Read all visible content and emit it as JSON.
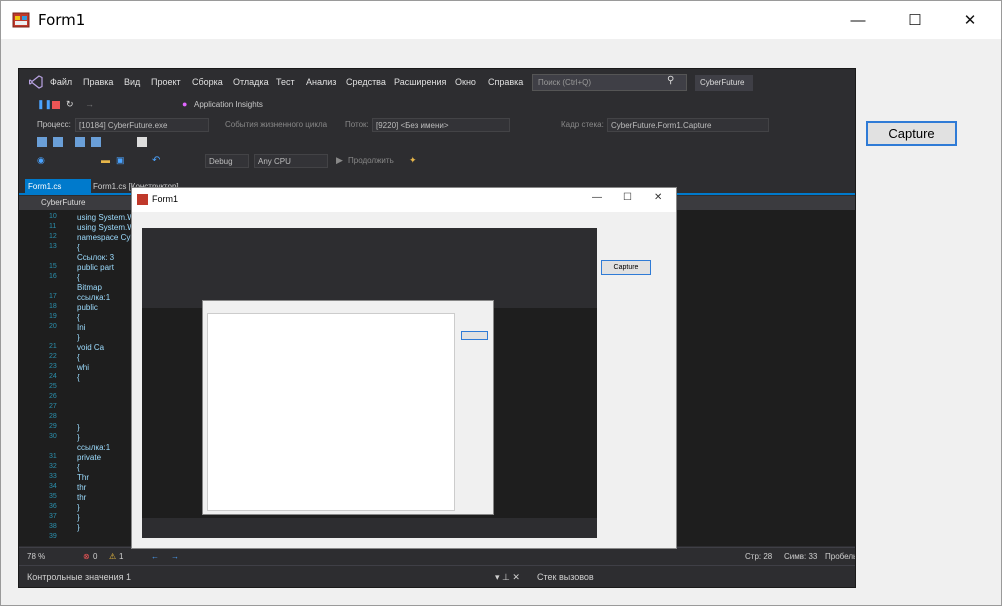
{
  "window": {
    "title": "Form1",
    "controls": {
      "minimize": "—",
      "maximize": "☐",
      "close": "✕"
    }
  },
  "capture_button": {
    "label": "Capture"
  },
  "screenshot": {
    "menu": [
      "Файл",
      "Правка",
      "Вид",
      "Проект",
      "Сборка",
      "Отладка",
      "Тест",
      "Анализ",
      "Средства",
      "Расширения",
      "Окно",
      "Справка"
    ],
    "search_placeholder": "Поиск (Ctrl+Q)",
    "profile": "CyberFuture",
    "toolbar": {
      "app_insights": "Application Insights",
      "process_label": "Процесс:",
      "process_value": "[10184] CyberFuture.exe",
      "lifecycle": "События жизненного цикла",
      "thread_label": "Поток:",
      "thread_value": "[9220] <Без имени>",
      "stack_label": "Кадр стека:",
      "stack_value": "CyberFuture.Form1.Capture",
      "config": "Debug",
      "platform": "Any CPU",
      "continue": "Продолжить"
    },
    "tabs": {
      "active": "Form1.cs",
      "other": "Form1.cs [Конструктор]"
    },
    "breadcrumb": "CyberFuture",
    "lines": [
      {
        "n": "10",
        "code": "using System.W"
      },
      {
        "n": "11",
        "code": "using System.Wi"
      },
      {
        "n": "12",
        "code": "namespace Cyber"
      },
      {
        "n": "13",
        "code": "{"
      },
      {
        "n": "",
        "code": "Ссылок: 3"
      },
      {
        "n": "15",
        "code": "public part"
      },
      {
        "n": "16",
        "code": "{"
      },
      {
        "n": "",
        "code": "Bitmap"
      },
      {
        "n": "17",
        "code": "ссылка:1"
      },
      {
        "n": "18",
        "code": "public"
      },
      {
        "n": "19",
        "code": "{"
      },
      {
        "n": "20",
        "code": "Ini"
      },
      {
        "n": "",
        "code": "}"
      },
      {
        "n": "21",
        "code": "void Ca"
      },
      {
        "n": "22",
        "code": "{"
      },
      {
        "n": "23",
        "code": "whi"
      },
      {
        "n": "24",
        "code": "{"
      },
      {
        "n": "25",
        "code": ""
      },
      {
        "n": "26",
        "code": ""
      },
      {
        "n": "27",
        "code": ""
      },
      {
        "n": "28",
        "code": ""
      },
      {
        "n": "29",
        "code": "}"
      },
      {
        "n": "30",
        "code": "}"
      },
      {
        "n": "",
        "code": "ссылка:1"
      },
      {
        "n": "31",
        "code": "private"
      },
      {
        "n": "32",
        "code": "{"
      },
      {
        "n": "33",
        "code": "Thr"
      },
      {
        "n": "34",
        "code": "thr"
      },
      {
        "n": "35",
        "code": "thr"
      },
      {
        "n": "36",
        "code": "}"
      },
      {
        "n": "37",
        "code": "}"
      },
      {
        "n": "38",
        "code": "}"
      },
      {
        "n": "39",
        "code": ""
      }
    ],
    "status": {
      "zoom": "78 %",
      "errors": "0",
      "warnings": "1",
      "line": "Стр: 28",
      "col": "Симв: 33",
      "spaces": "Пробелы"
    },
    "bottom": {
      "watch": "Контрольные значения 1",
      "callstack": "Стек вызовов"
    },
    "nested_window": {
      "title": "Form1",
      "button": "Capture"
    }
  }
}
